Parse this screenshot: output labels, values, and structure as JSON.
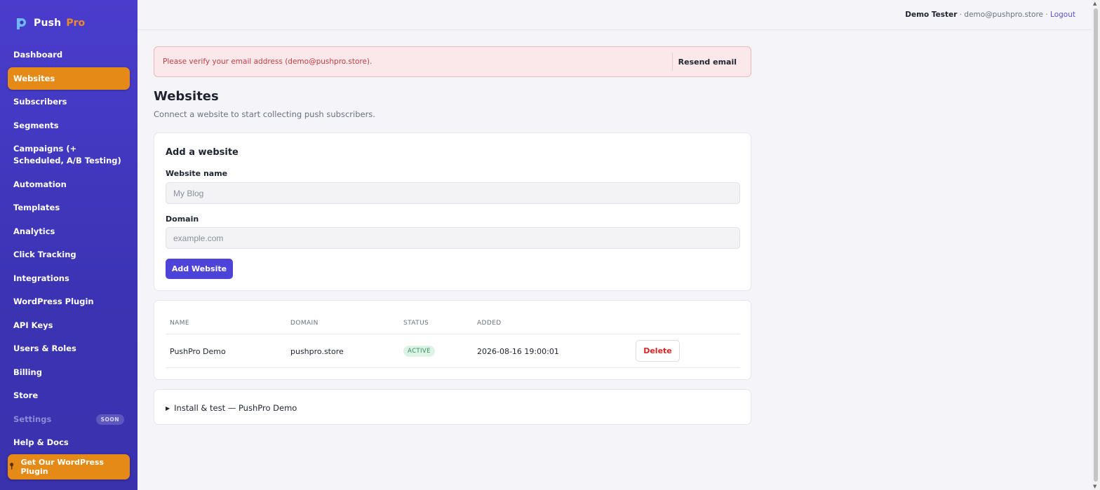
{
  "brand": {
    "name": "Push",
    "accent": "Pro",
    "accent_color": "#f08a24",
    "sidebar_color": "#3b33b3"
  },
  "sidebar": {
    "items": [
      {
        "label": "Dashboard"
      },
      {
        "label": "Websites",
        "active": true
      },
      {
        "label": "Subscribers"
      },
      {
        "label": "Segments"
      },
      {
        "label": "Campaigns (+ Scheduled, A/B Testing)"
      },
      {
        "label": "Automation"
      },
      {
        "label": "Templates"
      },
      {
        "label": "Analytics"
      },
      {
        "label": "Click Tracking"
      },
      {
        "label": "Integrations"
      },
      {
        "label": "WordPress Plugin"
      },
      {
        "label": "API Keys"
      },
      {
        "label": "Users & Roles"
      },
      {
        "label": "Billing"
      },
      {
        "label": "Store"
      },
      {
        "label": "Settings",
        "disabled": true,
        "badge": "SOON"
      },
      {
        "label": "Help & Docs"
      }
    ],
    "cta": {
      "label": "Get Our WordPress Plugin",
      "icon": "pin-icon"
    }
  },
  "header": {
    "user_name": "Demo Tester",
    "separator": "·",
    "user_email": "demo@pushpro.store",
    "logout": "Logout"
  },
  "alert": {
    "message": "Please verify your email address (demo@pushpro.store).",
    "action": "Resend email"
  },
  "page": {
    "title": "Websites",
    "subtitle": "Connect a website to start collecting push subscribers."
  },
  "form": {
    "heading": "Add a website",
    "name_label": "Website name",
    "name_placeholder": "My Blog",
    "domain_label": "Domain",
    "domain_placeholder": "example.com",
    "submit": "Add Website"
  },
  "table": {
    "headers": [
      "NAME",
      "DOMAIN",
      "STATUS",
      "ADDED"
    ],
    "rows": [
      {
        "name": "PushPro Demo",
        "domain": "pushpro.store",
        "status": "ACTIVE",
        "added": "2026-08-16 19:00:01",
        "action": "Delete"
      }
    ]
  },
  "install": {
    "label": "Install & test — PushPro Demo"
  }
}
